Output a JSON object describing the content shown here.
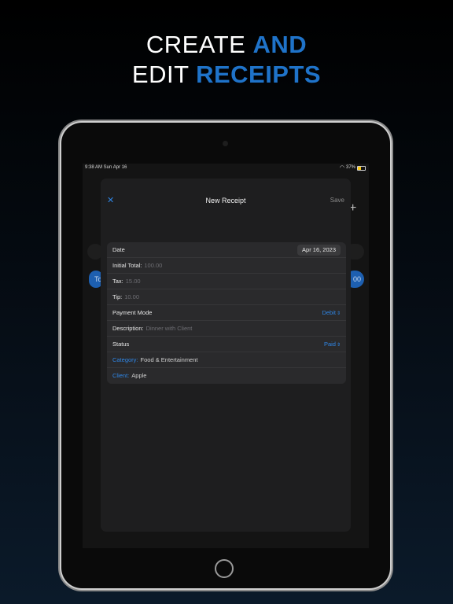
{
  "headline": {
    "line1_plain": "CREATE ",
    "line1_accent": "AND",
    "line2_plain": "EDIT ",
    "line2_accent": "RECEIPTS"
  },
  "status_bar": {
    "time_date": "9:38 AM  Sun Apr 16",
    "battery": "37%"
  },
  "background_screen": {
    "left_pill_text": "To",
    "right_pill_text": "00"
  },
  "sheet": {
    "title": "New Receipt",
    "save_label": "Save",
    "close_glyph": "✕"
  },
  "form": {
    "date_label": "Date",
    "date_value": "Apr 16, 2023",
    "initial_total_label": "Initial Total:",
    "initial_total_placeholder": "100.00",
    "tax_label": "Tax:",
    "tax_placeholder": "15.00",
    "tip_label": "Tip:",
    "tip_placeholder": "10.00",
    "payment_mode_label": "Payment Mode",
    "payment_mode_value": "Debit",
    "description_label": "Description:",
    "description_placeholder": "Dinner with Client",
    "status_label": "Status",
    "status_value": "Paid",
    "category_label": "Category:",
    "category_value": "Food & Entertainment",
    "client_label": "Client:",
    "client_value": "Apple"
  },
  "colors": {
    "accent": "#2f86e6",
    "headline_accent": "#1f73c9",
    "sheet_background": "#1e1e1f",
    "form_background": "#2a2a2c"
  },
  "icons": {
    "close": "close-icon",
    "add": "plus-icon",
    "wifi": "wifi-icon",
    "battery": "battery-icon",
    "chevron": "chevron-updown-icon"
  }
}
